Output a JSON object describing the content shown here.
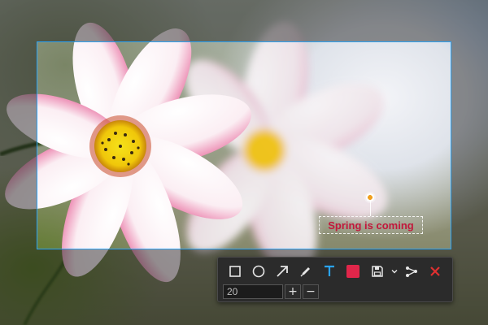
{
  "annotation": {
    "text": "Spring is coming",
    "color": "#c2183c"
  },
  "selection": {
    "border_color": "#2aa3f5"
  },
  "toolbar": {
    "tools": [
      {
        "name": "rectangle-tool",
        "icon": "square-icon"
      },
      {
        "name": "ellipse-tool",
        "icon": "circle-icon"
      },
      {
        "name": "arrow-tool",
        "icon": "arrow-icon"
      },
      {
        "name": "pen-tool",
        "icon": "pencil-icon"
      },
      {
        "name": "text-tool",
        "icon": "text-icon",
        "active": true,
        "active_color": "#2aa3f5"
      },
      {
        "name": "color-picker",
        "icon": "color-swatch-icon",
        "color": "#e0264a"
      },
      {
        "name": "save-tool",
        "icon": "save-icon"
      },
      {
        "name": "share-tool",
        "icon": "share-icon"
      },
      {
        "name": "cancel-tool",
        "icon": "close-icon",
        "color": "#e03030"
      }
    ],
    "font_size": {
      "value": "20",
      "increase_label": "+",
      "decrease_label": "−"
    }
  }
}
